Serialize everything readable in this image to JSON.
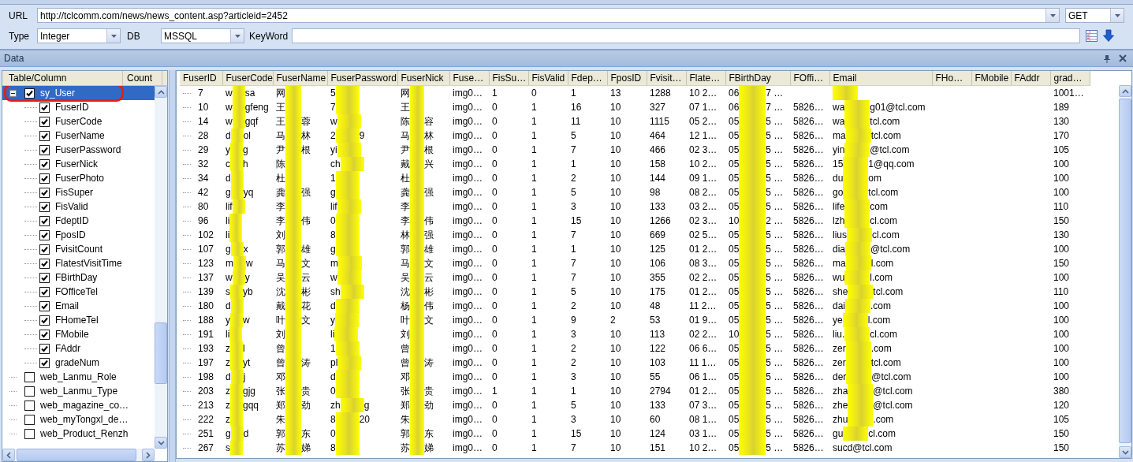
{
  "toolbar": {
    "url_label": "URL",
    "url": "http://tclcomm.com/news/news_content.asp?articleid=2452",
    "method": "GET",
    "type_label": "Type",
    "type": "Integer",
    "db_label": "DB",
    "db": "MSSQL",
    "keyword_label": "KeyWord"
  },
  "panel": {
    "title": "Data"
  },
  "tree": {
    "columns": [
      "Table/Column",
      "Count"
    ],
    "items": [
      {
        "label": "sy_User",
        "checked": true,
        "expanded": true,
        "selected": true,
        "highlighted": true,
        "children": [
          {
            "label": "FuserID",
            "checked": true,
            "selected": false
          },
          {
            "label": "FuserCode",
            "checked": true,
            "selected": false
          },
          {
            "label": "FuserName",
            "checked": true,
            "selected": false
          },
          {
            "label": "FuserPassword",
            "checked": true,
            "selected": false
          },
          {
            "label": "FuserNick",
            "checked": true,
            "selected": false
          },
          {
            "label": "FuserPhoto",
            "checked": true,
            "selected": false
          },
          {
            "label": "FisSuper",
            "checked": true,
            "selected": false
          },
          {
            "label": "FisValid",
            "checked": true,
            "selected": false
          },
          {
            "label": "FdeptID",
            "checked": true,
            "selected": false
          },
          {
            "label": "FposID",
            "checked": true,
            "selected": false
          },
          {
            "label": "FvisitCount",
            "checked": true,
            "selected": false
          },
          {
            "label": "FlatestVisitTime",
            "checked": true,
            "selected": false
          },
          {
            "label": "FBirthDay",
            "checked": true,
            "selected": false
          },
          {
            "label": "FOfficeTel",
            "checked": true,
            "selected": false
          },
          {
            "label": "Email",
            "checked": true,
            "selected": false
          },
          {
            "label": "FHomeTel",
            "checked": true,
            "selected": false
          },
          {
            "label": "FMobile",
            "checked": true,
            "selected": false
          },
          {
            "label": "FAddr",
            "checked": true,
            "selected": false
          },
          {
            "label": "gradeNum",
            "checked": true,
            "selected": false
          }
        ]
      },
      {
        "label": "web_Lanmu_Role",
        "checked": false,
        "selected": false,
        "highlighted": false
      },
      {
        "label": "web_Lanmu_Type",
        "checked": false,
        "selected": false,
        "highlighted": false
      },
      {
        "label": "web_magazine_co…",
        "checked": false,
        "selected": false,
        "highlighted": false
      },
      {
        "label": "web_myTongxl_de…",
        "checked": false,
        "selected": false,
        "highlighted": false
      },
      {
        "label": "web_Product_Renzh",
        "checked": false,
        "selected": false,
        "highlighted": false
      }
    ]
  },
  "table": {
    "columns": [
      "FuserID",
      "FuserCode",
      "FuserName",
      "FuserPassword",
      "FuserNick",
      "Fuse…",
      "FisSu…",
      "FisValid",
      "Fdep…",
      "FposID",
      "Fvisit…",
      "Flate…",
      "FBirthDay",
      "FOffi…",
      "Email",
      "FHo…",
      "FMobile",
      "FAddr",
      "grad…"
    ],
    "rows": [
      [
        "7",
        {
          "redacted": true,
          "before": "w",
          "after": "sa"
        },
        {
          "redacted": true,
          "before": "网"
        },
        {
          "redacted": true,
          "before": "5"
        },
        {
          "redacted": true,
          "before": "网"
        },
        "img0…",
        "1",
        "0",
        "1",
        "13",
        "1288",
        "10 2…",
        {
          "redacted": true,
          "before": "06",
          "after": "7 …"
        },
        null,
        {
          "redacted": true
        },
        null,
        null,
        null,
        "1001…"
      ],
      [
        "10",
        {
          "redacted": true,
          "before": "w",
          "after": "gfeng"
        },
        {
          "redacted": true,
          "before": "王"
        },
        {
          "redacted": true,
          "before": "7"
        },
        {
          "redacted": true,
          "before": "王"
        },
        "img0…",
        "0",
        "1",
        "16",
        "10",
        "327",
        "07 1…",
        {
          "redacted": true,
          "before": "06",
          "after": "7 …"
        },
        "5826…",
        {
          "redacted": true,
          "before": "wa",
          "after": "g01@tcl.com"
        },
        null,
        null,
        null,
        "189"
      ],
      [
        "14",
        {
          "redacted": true,
          "before": "w",
          "after": "gqf"
        },
        {
          "redacted": true,
          "before": "王",
          "after": "蓉"
        },
        {
          "redacted": true,
          "before": "w"
        },
        {
          "redacted": true,
          "before": "陈",
          "after": "容"
        },
        "img0…",
        "0",
        "1",
        "11",
        "10",
        "1115",
        "05 2…",
        {
          "redacted": true,
          "before": "05",
          "after": "5 …"
        },
        "5826…",
        {
          "redacted": true,
          "before": "wa",
          "after": "tcl.com"
        },
        null,
        null,
        null,
        "130"
      ],
      [
        "28",
        {
          "redacted": true,
          "before": "d",
          "after": "ol"
        },
        {
          "redacted": true,
          "before": "马",
          "after": "林"
        },
        {
          "redacted": true,
          "before": "2",
          "after": "9"
        },
        {
          "redacted": true,
          "before": "马",
          "after": "林"
        },
        "img0…",
        "0",
        "1",
        "5",
        "10",
        "464",
        "12 1…",
        {
          "redacted": true,
          "before": "05",
          "after": "5 …"
        },
        "5826…",
        {
          "redacted": true,
          "before": "ma",
          "after": "tcl.com"
        },
        null,
        null,
        null,
        "170"
      ],
      [
        "29",
        {
          "redacted": true,
          "before": "y",
          "after": "g"
        },
        {
          "redacted": true,
          "before": "尹",
          "after": "根"
        },
        {
          "redacted": true,
          "before": "yi"
        },
        {
          "redacted": true,
          "before": "尹",
          "after": "根"
        },
        "img0…",
        "0",
        "1",
        "7",
        "10",
        "466",
        "02 3…",
        {
          "redacted": true,
          "before": "05",
          "after": "5 …"
        },
        "5826…",
        {
          "redacted": true,
          "before": "yin",
          "after": "@tcl.com"
        },
        null,
        null,
        null,
        "105"
      ],
      [
        "32",
        {
          "redacted": true,
          "before": "c",
          "after": "h"
        },
        {
          "redacted": true,
          "before": "陈"
        },
        {
          "redacted": true,
          "before": "ch"
        },
        {
          "redacted": true,
          "before": "戴",
          "after": "兴"
        },
        "img0…",
        "0",
        "1",
        "1",
        "10",
        "158",
        "10 2…",
        {
          "redacted": true,
          "before": "05",
          "after": "5 …"
        },
        "5826…",
        {
          "redacted": true,
          "before": "15",
          "after": "1@qq.com"
        },
        null,
        null,
        null,
        "100"
      ],
      [
        "34",
        {
          "redacted": true,
          "before": "d"
        },
        {
          "redacted": true,
          "before": "杜"
        },
        {
          "redacted": true,
          "before": "1"
        },
        {
          "redacted": true,
          "before": "杜"
        },
        "img0…",
        "0",
        "1",
        "2",
        "10",
        "144",
        "09 1…",
        {
          "redacted": true,
          "before": "05",
          "after": "5 …"
        },
        "5826…",
        {
          "redacted": true,
          "before": "du",
          "after": "om"
        },
        null,
        null,
        null,
        "100"
      ],
      [
        "42",
        {
          "redacted": true,
          "before": "g",
          "after": "yq"
        },
        {
          "redacted": true,
          "before": "龚",
          "after": "强"
        },
        {
          "redacted": true,
          "before": "g"
        },
        {
          "redacted": true,
          "before": "龚",
          "after": "强"
        },
        "img0…",
        "0",
        "1",
        "5",
        "10",
        "98",
        "08 2…",
        {
          "redacted": true,
          "before": "05",
          "after": "5 …"
        },
        "5826…",
        {
          "redacted": true,
          "before": "go",
          "after": "tcl.com"
        },
        null,
        null,
        null,
        "100"
      ],
      [
        "80",
        {
          "redacted": true,
          "before": "lif"
        },
        {
          "redacted": true,
          "before": "李"
        },
        {
          "redacted": true,
          "before": "lif"
        },
        {
          "redacted": true,
          "before": "李"
        },
        "img0…",
        "0",
        "1",
        "3",
        "10",
        "133",
        "03 2…",
        {
          "redacted": true,
          "before": "05",
          "after": "5 …"
        },
        "5826…",
        {
          "redacted": true,
          "before": "life",
          "after": "com"
        },
        null,
        null,
        null,
        "110"
      ],
      [
        "96",
        {
          "redacted": true,
          "before": "li"
        },
        {
          "redacted": true,
          "before": "李",
          "after": "伟"
        },
        {
          "redacted": true,
          "before": "0"
        },
        {
          "redacted": true,
          "before": "李",
          "after": "伟"
        },
        "img0…",
        "0",
        "1",
        "15",
        "10",
        "1266",
        "02 3…",
        {
          "redacted": true,
          "before": "10",
          "after": "2 …"
        },
        "5826…",
        {
          "redacted": true,
          "before": "lzh",
          "after": "cl.com"
        },
        null,
        null,
        null,
        "150"
      ],
      [
        "102",
        {
          "redacted": true,
          "before": "li"
        },
        {
          "redacted": true,
          "before": "刘"
        },
        {
          "redacted": true,
          "before": "8"
        },
        {
          "redacted": true,
          "before": "林",
          "after": "强"
        },
        "img0…",
        "0",
        "1",
        "7",
        "10",
        "669",
        "02 5…",
        {
          "redacted": true,
          "before": "05",
          "after": "5 …"
        },
        "5826…",
        {
          "redacted": true,
          "before": "lius",
          "after": "cl.com"
        },
        null,
        null,
        null,
        "130"
      ],
      [
        "107",
        {
          "redacted": true,
          "before": "g",
          "after": "x"
        },
        {
          "redacted": true,
          "before": "郭",
          "after": "雄"
        },
        {
          "redacted": true,
          "before": "g"
        },
        {
          "redacted": true,
          "before": "郭",
          "after": "雄"
        },
        "img0…",
        "0",
        "1",
        "1",
        "10",
        "125",
        "01 2…",
        {
          "redacted": true,
          "before": "05",
          "after": "5 …"
        },
        "5826…",
        {
          "redacted": true,
          "before": "dia",
          "after": "@tcl.com"
        },
        null,
        null,
        null,
        "100"
      ],
      [
        "123",
        {
          "redacted": true,
          "before": "m",
          "after": "w"
        },
        {
          "redacted": true,
          "before": "马",
          "after": "文"
        },
        {
          "redacted": true,
          "before": "m"
        },
        {
          "redacted": true,
          "before": "马",
          "after": "文"
        },
        "img0…",
        "0",
        "1",
        "7",
        "10",
        "106",
        "08 3…",
        {
          "redacted": true,
          "before": "05",
          "after": "5 …"
        },
        "5826…",
        {
          "redacted": true,
          "before": "ma",
          "after": "l.com"
        },
        null,
        null,
        null,
        "150"
      ],
      [
        "137",
        {
          "redacted": true,
          "before": "w",
          "after": "y"
        },
        {
          "redacted": true,
          "before": "吴",
          "after": "云"
        },
        {
          "redacted": true,
          "before": "w"
        },
        {
          "redacted": true,
          "before": "吴",
          "after": "云"
        },
        "img0…",
        "0",
        "1",
        "7",
        "10",
        "355",
        "02 2…",
        {
          "redacted": true,
          "before": "05",
          "after": "5 …"
        },
        "5826…",
        {
          "redacted": true,
          "before": "wu",
          "after": "l.com"
        },
        null,
        null,
        null,
        "100"
      ],
      [
        "139",
        {
          "redacted": true,
          "before": "s",
          "after": "yb"
        },
        {
          "redacted": true,
          "before": "沈",
          "after": "彬"
        },
        {
          "redacted": true,
          "before": "sh"
        },
        {
          "redacted": true,
          "before": "沈",
          "after": "彬"
        },
        "img0…",
        "0",
        "1",
        "5",
        "10",
        "175",
        "01 2…",
        {
          "redacted": true,
          "before": "05",
          "after": "5 …"
        },
        "5826…",
        {
          "redacted": true,
          "before": "she",
          "after": "tcl.com"
        },
        null,
        null,
        null,
        "110"
      ],
      [
        "180",
        {
          "redacted": true,
          "before": "d"
        },
        {
          "redacted": true,
          "before": "戴",
          "after": "花"
        },
        {
          "redacted": true,
          "before": "d"
        },
        {
          "redacted": true,
          "before": "杨",
          "after": "伟"
        },
        "img0…",
        "0",
        "1",
        "2",
        "10",
        "48",
        "11 2…",
        {
          "redacted": true,
          "before": "05",
          "after": "5 …"
        },
        "5826…",
        {
          "redacted": true,
          "before": "dai",
          "after": ".com"
        },
        null,
        null,
        null,
        "100"
      ],
      [
        "188",
        {
          "redacted": true,
          "before": "y",
          "after": "w"
        },
        {
          "redacted": true,
          "before": "叶",
          "after": "文"
        },
        {
          "redacted": true,
          "before": "y"
        },
        {
          "redacted": true,
          "before": "叶",
          "after": "文"
        },
        "img0…",
        "0",
        "1",
        "9",
        "2",
        "53",
        "01 9…",
        {
          "redacted": true,
          "before": "05",
          "after": "5 …"
        },
        "5826…",
        {
          "redacted": true,
          "before": "ye",
          "after": "l.com"
        },
        null,
        null,
        null,
        "100"
      ],
      [
        "191",
        {
          "redacted": true,
          "before": "li"
        },
        {
          "redacted": true,
          "before": "刘"
        },
        {
          "redacted": true,
          "before": "li"
        },
        {
          "redacted": true,
          "before": "刘"
        },
        "img0…",
        "0",
        "1",
        "3",
        "10",
        "113",
        "02 2…",
        {
          "redacted": true,
          "before": "10",
          "after": "5 …"
        },
        "5826…",
        {
          "redacted": true,
          "before": "liu.",
          "after": "cl.com"
        },
        null,
        null,
        null,
        "100"
      ],
      [
        "193",
        {
          "redacted": true,
          "before": "z",
          "after": "l"
        },
        {
          "redacted": true,
          "before": "曾"
        },
        {
          "redacted": true,
          "before": "1"
        },
        {
          "redacted": true,
          "before": "曾"
        },
        "img0…",
        "0",
        "1",
        "2",
        "10",
        "122",
        "06 6…",
        {
          "redacted": true,
          "before": "05",
          "after": "5 …"
        },
        "5826…",
        {
          "redacted": true,
          "before": "zer",
          "after": ".com"
        },
        null,
        null,
        null,
        "100"
      ],
      [
        "197",
        {
          "redacted": true,
          "before": "z",
          "after": "yt"
        },
        {
          "redacted": true,
          "before": "曾",
          "after": "涛"
        },
        {
          "redacted": true,
          "before": "pl"
        },
        {
          "redacted": true,
          "before": "曾",
          "after": "涛"
        },
        "img0…",
        "0",
        "1",
        "2",
        "10",
        "103",
        "11 1…",
        {
          "redacted": true,
          "before": "05",
          "after": "5 …"
        },
        "5826…",
        {
          "redacted": true,
          "before": "zer",
          "after": "tcl.com"
        },
        null,
        null,
        null,
        "100"
      ],
      [
        "198",
        {
          "redacted": true,
          "before": "d",
          "after": "j"
        },
        {
          "redacted": true,
          "before": "邓"
        },
        {
          "redacted": true,
          "before": "d"
        },
        {
          "redacted": true,
          "before": "邓"
        },
        "img0…",
        "0",
        "1",
        "3",
        "10",
        "55",
        "06 1…",
        {
          "redacted": true,
          "before": "05",
          "after": "5 …"
        },
        "5826…",
        {
          "redacted": true,
          "before": "der",
          "after": "@tcl.com"
        },
        null,
        null,
        null,
        "100"
      ],
      [
        "203",
        {
          "redacted": true,
          "before": "z",
          "after": "gjg"
        },
        {
          "redacted": true,
          "before": "张",
          "after": "贵"
        },
        {
          "redacted": true,
          "before": "0"
        },
        {
          "redacted": true,
          "before": "张",
          "after": "贵"
        },
        "img0…",
        "1",
        "1",
        "1",
        "10",
        "2794",
        "01 2…",
        {
          "redacted": true,
          "before": "05",
          "after": "5 …"
        },
        "5826…",
        {
          "redacted": true,
          "before": "zha",
          "after": "@tcl.com"
        },
        null,
        null,
        null,
        "380"
      ],
      [
        "213",
        {
          "redacted": true,
          "before": "z",
          "after": "gqq"
        },
        {
          "redacted": true,
          "before": "郑",
          "after": "劲"
        },
        {
          "redacted": true,
          "before": "zh",
          "after": "g"
        },
        {
          "redacted": true,
          "before": "郑",
          "after": "劲"
        },
        "img0…",
        "0",
        "1",
        "5",
        "10",
        "133",
        "07 3…",
        {
          "redacted": true,
          "before": "05",
          "after": "5 …"
        },
        "5826…",
        {
          "redacted": true,
          "before": "zhe",
          "after": "@tcl.com"
        },
        null,
        null,
        null,
        "120"
      ],
      [
        "222",
        {
          "redacted": true,
          "before": "z"
        },
        {
          "redacted": true,
          "before": "朱"
        },
        {
          "redacted": true,
          "before": "8",
          "after": "20"
        },
        {
          "redacted": true,
          "before": "朱"
        },
        "img0…",
        "0",
        "1",
        "3",
        "10",
        "60",
        "08 1…",
        {
          "redacted": true,
          "before": "05",
          "after": "5 …"
        },
        "5826…",
        {
          "redacted": true,
          "before": "zhu",
          "after": ".com"
        },
        null,
        null,
        null,
        "105"
      ],
      [
        "251",
        {
          "redacted": true,
          "before": "g",
          "after": "d"
        },
        {
          "redacted": true,
          "before": "郭",
          "after": "东"
        },
        {
          "redacted": true,
          "before": "0"
        },
        {
          "redacted": true,
          "before": "郭",
          "after": "东"
        },
        "img0…",
        "0",
        "1",
        "15",
        "10",
        "124",
        "03 1…",
        {
          "redacted": true,
          "before": "05",
          "after": "5 …"
        },
        "5826…",
        {
          "redacted": true,
          "before": "gu",
          "after": "cl.com"
        },
        null,
        null,
        null,
        "150"
      ],
      [
        "267",
        {
          "redacted": true,
          "before": "s"
        },
        {
          "redacted": true,
          "before": "苏",
          "after": "娣"
        },
        {
          "redacted": true,
          "before": "8"
        },
        {
          "redacted": true,
          "before": "苏",
          "after": "娣"
        },
        "img0…",
        "0",
        "1",
        "7",
        "10",
        "151",
        "10 2…",
        {
          "redacted": true,
          "before": "05",
          "after": "5 …"
        },
        "5826…",
        "sucd@tcl.com",
        null,
        null,
        null,
        "150"
      ]
    ]
  }
}
